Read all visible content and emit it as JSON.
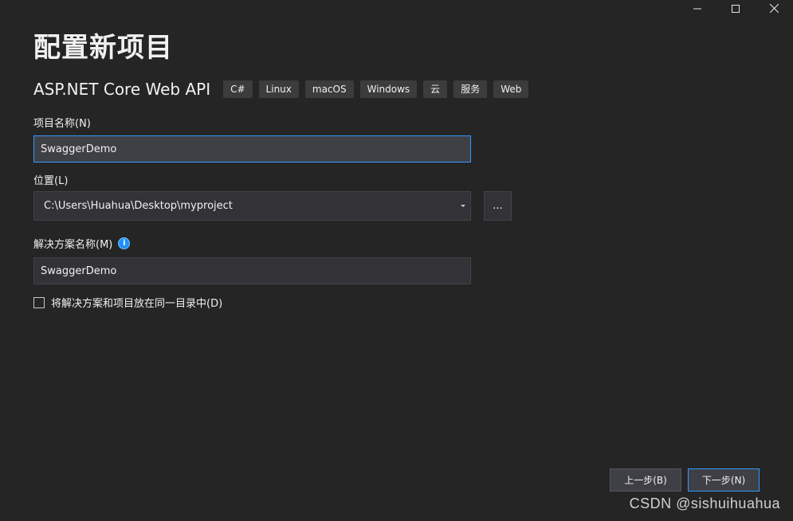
{
  "window": {
    "controls": {
      "minimize_glyph": "−",
      "maximize_glyph": "☐",
      "close_glyph": "✕"
    }
  },
  "page": {
    "title": "配置新项目"
  },
  "template": {
    "name": "ASP.NET Core Web API",
    "tags": [
      "C#",
      "Linux",
      "macOS",
      "Windows",
      "云",
      "服务",
      "Web"
    ]
  },
  "project_name": {
    "label": "项目名称(N)",
    "value": "SwaggerDemo"
  },
  "location": {
    "label": "位置(L)",
    "value": "C:\\Users\\Huahua\\Desktop\\myproject",
    "browse_label": "..."
  },
  "solution_name": {
    "label": "解决方案名称(M)",
    "info_glyph": "i",
    "value": "SwaggerDemo"
  },
  "same_directory": {
    "label": "将解决方案和项目放在同一目录中(D)",
    "checked": false
  },
  "footer": {
    "back_label": "上一步(B)",
    "next_label": "下一步(N)"
  },
  "watermark": {
    "text": "CSDN @sishuihuahua"
  },
  "colors": {
    "background": "#252526",
    "input_background": "#333337",
    "focus_border": "#3399ff",
    "info_icon": "#1e90ff",
    "tag_background": "#3c3c3c"
  }
}
